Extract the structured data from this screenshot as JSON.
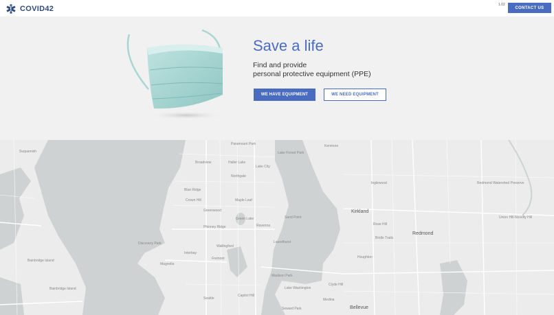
{
  "header": {
    "brand": "COVID42",
    "version": "1.02",
    "contact_label": "CONTACT US"
  },
  "hero": {
    "title": "Save a life",
    "subtitle_line1": "Find and provide",
    "subtitle_line2": "personal protective equipment (PPE)",
    "have_label": "WE HAVE EQUIPMENT",
    "need_label": "WE NEED EQUIPMENT"
  },
  "map": {
    "labels": [
      "Suquamish",
      "Paramount Park",
      "Broadview",
      "Haller Lake",
      "Lake City",
      "Northgate",
      "Maple Leaf",
      "Greenwood",
      "Green Lake",
      "Ravenna",
      "Phinney Ridge",
      "Wallingford",
      "Fremont",
      "Magnolia",
      "Interbay",
      "Laurelhurst",
      "Madison Park",
      "Capitol Hill",
      "Lake Washington",
      "Kirkland",
      "Redmond",
      "Bellevue",
      "Bainbridge Island",
      "Bainbridge Island",
      "Union Hill-Novelty Hill",
      "Redmond Watershed Preserve",
      "Clyde Hill",
      "Medina",
      "Houghton",
      "Bridle Trails",
      "Rose Hill",
      "Blue Ridge",
      "Crown Hill",
      "Discovery Park",
      "Kenmore",
      "Lake Forest Park",
      "Inglewood",
      "Seattle",
      "Sand Point",
      "Seward Park"
    ]
  }
}
